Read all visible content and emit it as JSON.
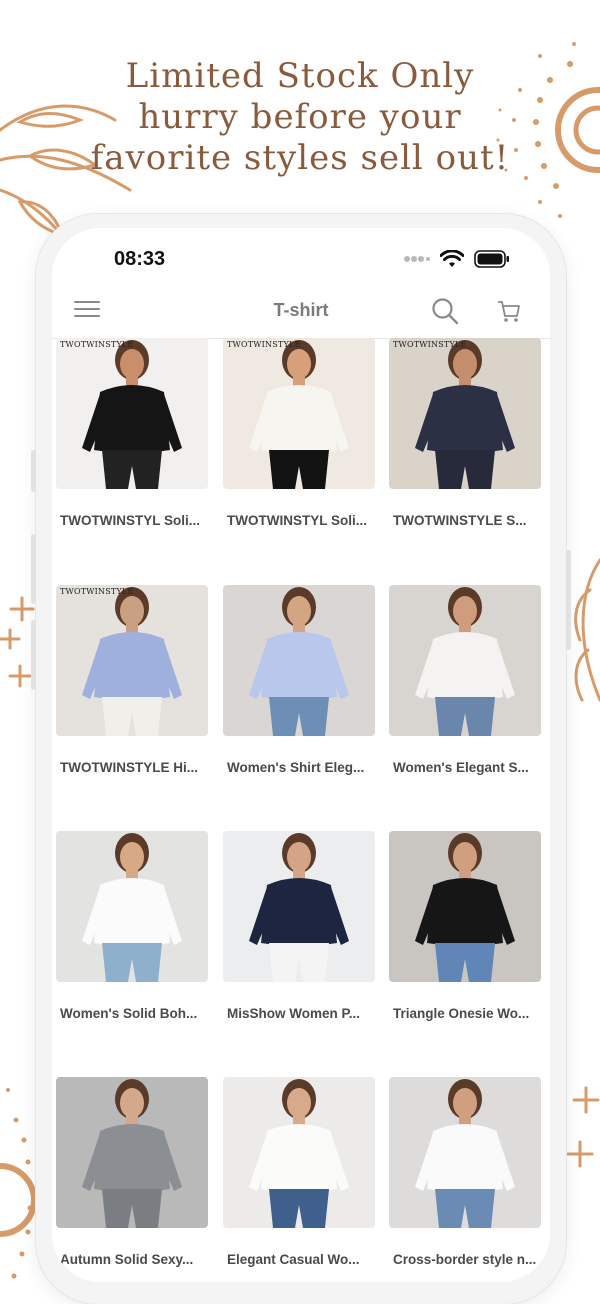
{
  "promo": {
    "line1": "Limited Stock Only",
    "line2": "hurry before your",
    "line3": "favorite styles sell out!"
  },
  "status_bar": {
    "time": "08:33",
    "icons": [
      "signal-dots-icon",
      "wifi-icon",
      "battery-icon"
    ]
  },
  "navbar": {
    "title": "T-shirt",
    "left_icon": "menu-icon",
    "right_icons": [
      "search-icon",
      "cart-icon"
    ]
  },
  "products": [
    {
      "name": "TWOTWINSTYL Soli...",
      "brand_tag": "TWOTWINSTYLE",
      "bg": "#f2f0ee",
      "top": "#151515",
      "bottom": "#222222",
      "skin": "#c98f6b"
    },
    {
      "name": "TWOTWINSTYL Soli...",
      "brand_tag": "TWOTWINSTYLE",
      "bg": "#efe9e2",
      "top": "#f7f5f0",
      "bottom": "#121212",
      "skin": "#d7a07b"
    },
    {
      "name": "TWOTWINSTYLE S...",
      "brand_tag": "TWOTWINSTYLE",
      "bg": "#d9d3ca",
      "top": "#2b3044",
      "bottom": "#262a3a",
      "skin": "#c58f6e"
    },
    {
      "name": "TWOTWINSTYLE Hi...",
      "brand_tag": "TWOTWINSTYLE",
      "bg": "#e5e1dc",
      "top": "#9fb0dd",
      "bottom": "#f1efea",
      "skin": "#caa083"
    },
    {
      "name": "Women's Shirt Eleg...",
      "brand_tag": "",
      "bg": "#d9d6d3",
      "top": "#b8c8ec",
      "bottom": "#6d8fb5",
      "skin": "#d3a582"
    },
    {
      "name": "Women's Elegant S...",
      "brand_tag": "",
      "bg": "#d8d4d0",
      "top": "#f4f3f1",
      "bottom": "#6b86ad",
      "skin": "#cf9c7c"
    },
    {
      "name": "Women's Solid Boh...",
      "brand_tag": "",
      "bg": "#e3e4e2",
      "top": "#fbfbfb",
      "bottom": "#8fb0cc",
      "skin": "#d8a985"
    },
    {
      "name": "MisShow Women P...",
      "brand_tag": "",
      "bg": "#ecedee",
      "top": "#1e2540",
      "bottom": "#f4f4f4",
      "skin": "#d5a486"
    },
    {
      "name": "Triangle Onesie Wo...",
      "brand_tag": "",
      "bg": "#c9c6c2",
      "top": "#161616",
      "bottom": "#5f86b6",
      "skin": "#cf9f7e"
    },
    {
      "name": "Autumn Solid Sexy...",
      "brand_tag": "",
      "bg": "#b9b9b9",
      "top": "#8b8e92",
      "bottom": "#7a7e83",
      "skin": "#d3a88b"
    },
    {
      "name": "Elegant Casual Wo...",
      "brand_tag": "",
      "bg": "#ecebe9",
      "top": "#fbfbfa",
      "bottom": "#3f5f8c",
      "skin": "#d6aa8a"
    },
    {
      "name": "Cross-border style n...",
      "brand_tag": "",
      "bg": "#dedcda",
      "top": "#fafafa",
      "bottom": "#6a8bb4",
      "skin": "#cf9f80"
    }
  ],
  "colors": {
    "headline": "#8a5a3c",
    "accent_decor": "#d79b6a",
    "product_name": "#4a4a4a",
    "nav_title": "#7a7a7a"
  }
}
